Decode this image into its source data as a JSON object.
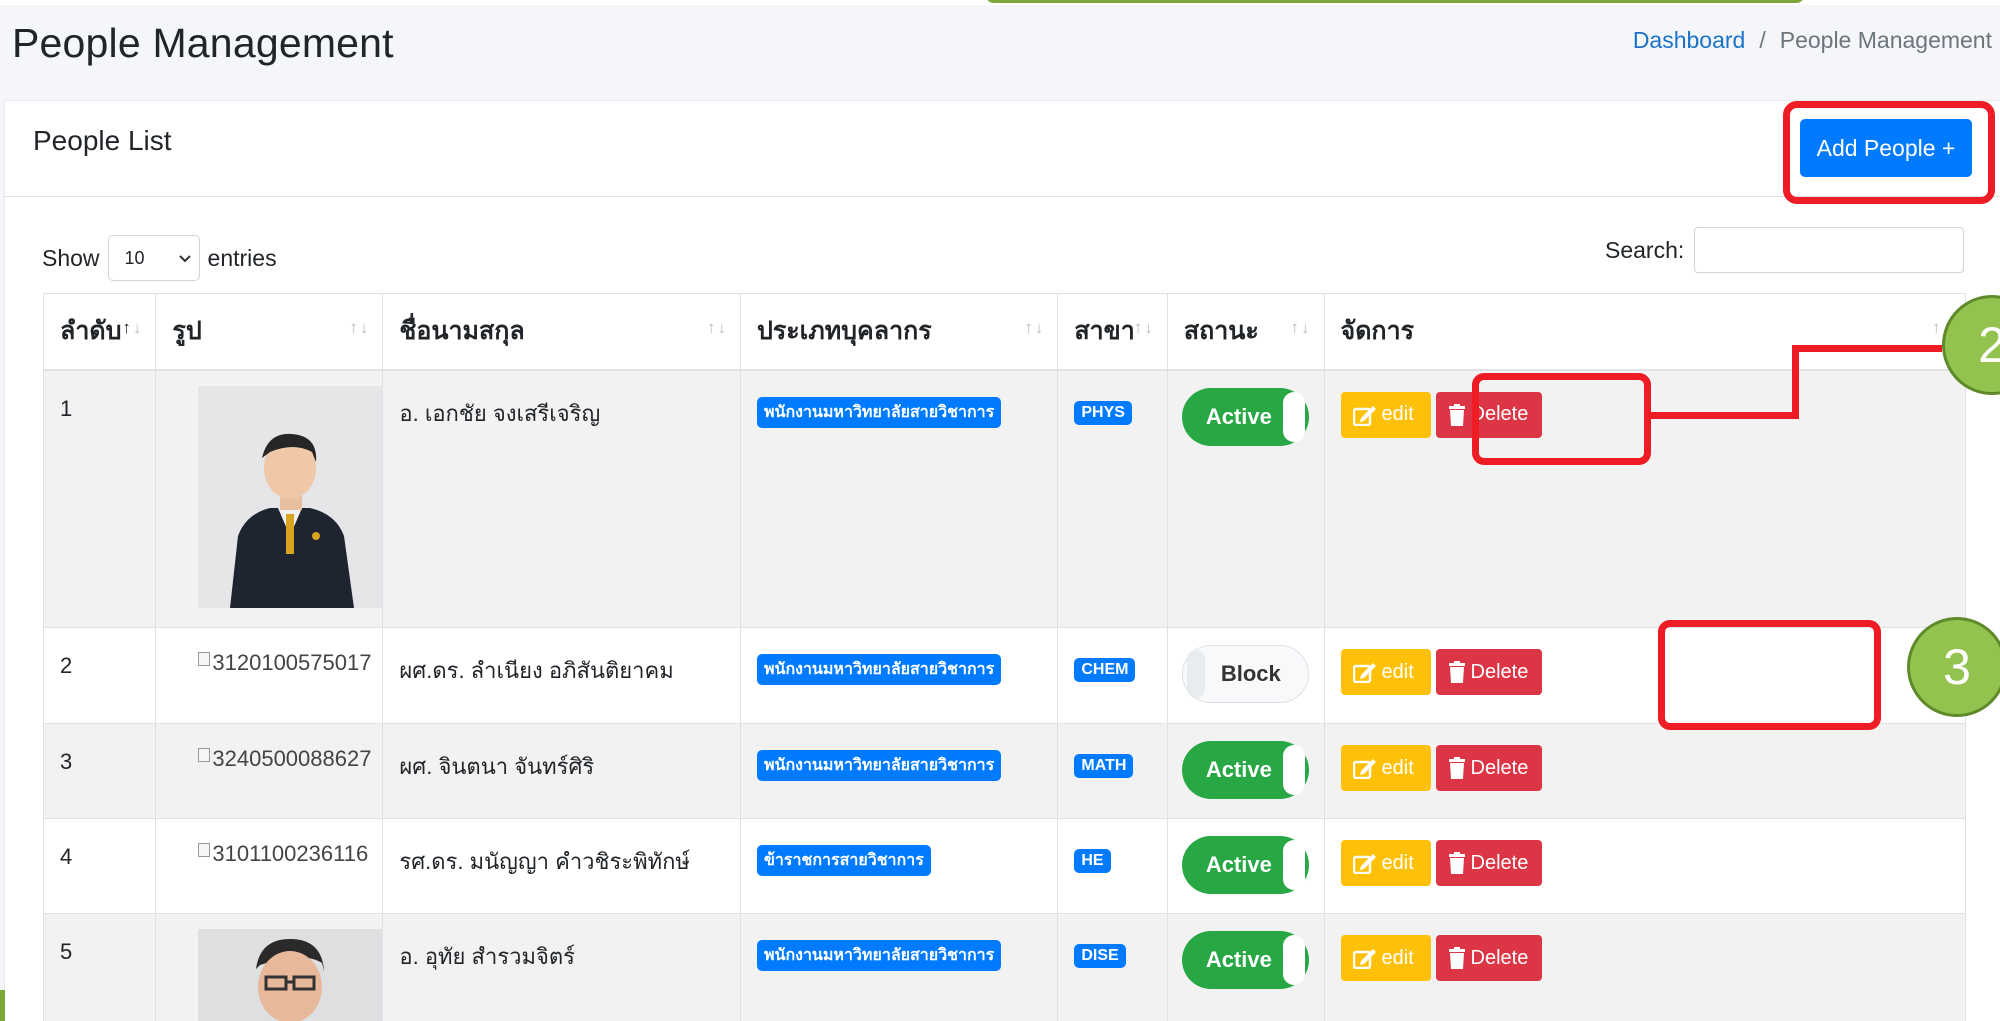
{
  "page": {
    "title": "People Management",
    "breadcrumb": {
      "home": "Dashboard",
      "separator": "/",
      "current": "People Management"
    }
  },
  "card": {
    "title": "People List",
    "add_button": "Add People +"
  },
  "length_menu": {
    "show": "Show",
    "value": "10",
    "entries": "entries"
  },
  "search": {
    "label": "Search:",
    "value": ""
  },
  "table": {
    "columns": [
      "ลำดับ",
      "รูป",
      "ชื่อนามสกุล",
      "ประเภทบุคลากร",
      "สาขา",
      "สถานะ",
      "จัดการ"
    ],
    "rows": [
      {
        "no": "1",
        "photo_alt": "",
        "name": "อ. เอกชัย จงเสรีเจริญ",
        "type": "พนักงานมหาวิทยาลัยสายวิชาการ",
        "branch": "PHYS",
        "status": "Active",
        "edit": "edit",
        "delete": "Delete"
      },
      {
        "no": "2",
        "photo_alt": "3120100575017",
        "name": "ผศ.ดร. ลำเนียง อภิสันติยาคม",
        "type": "พนักงานมหาวิทยาลัยสายวิชาการ",
        "branch": "CHEM",
        "status": "Block",
        "edit": "edit",
        "delete": "Delete"
      },
      {
        "no": "3",
        "photo_alt": "3240500088627",
        "name": "ผศ. จินตนา จันทร์ศิริ",
        "type": "พนักงานมหาวิทยาลัยสายวิชาการ",
        "branch": "MATH",
        "status": "Active",
        "edit": "edit",
        "delete": "Delete"
      },
      {
        "no": "4",
        "photo_alt": "3101100236116",
        "name": "รศ.ดร. มนัญญา คำวชิระพิทักษ์",
        "type": "ข้าราชการสายวิชาการ",
        "branch": "HE",
        "status": "Active",
        "edit": "edit",
        "delete": "Delete"
      },
      {
        "no": "5",
        "photo_alt": "",
        "name": "อ. อุทัย สำรวมจิตร์",
        "type": "พนักงานมหาวิทยาลัยสายวิชาการ",
        "branch": "DISE",
        "status": "Active",
        "edit": "edit",
        "delete": "Delete"
      }
    ]
  },
  "callouts": {
    "two": "2",
    "three": "3"
  },
  "colors": {
    "primary": "#007bff",
    "success": "#28a745",
    "warning": "#ffc107",
    "danger": "#dc3545",
    "highlight": "#ee1c25",
    "callout": "#93c34e"
  }
}
